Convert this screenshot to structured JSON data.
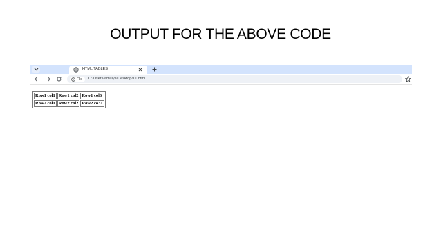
{
  "slide": {
    "title": "OUTPUT FOR THE ABOVE CODE"
  },
  "browser": {
    "tab": {
      "title": "HTML TABLES"
    },
    "address": {
      "chip_label": "File",
      "url": "C:/Users/amulya/Desktop/T1.html"
    },
    "icons": [
      "tab-search-icon",
      "favicon-icon",
      "close-icon",
      "plus-icon",
      "back-icon",
      "forward-icon",
      "reload-icon",
      "info-icon",
      "star-icon"
    ]
  },
  "table": {
    "rows": [
      [
        "Row1 col1",
        "Row1 col2",
        "Row1 col3"
      ],
      [
        "Row2 col1",
        "Row2 col2",
        "Row2 co31"
      ]
    ]
  },
  "colors": {
    "tabstrip": "#d3e3fd",
    "omnibox": "#eef1f6",
    "table_border": "#7a7a7a"
  }
}
